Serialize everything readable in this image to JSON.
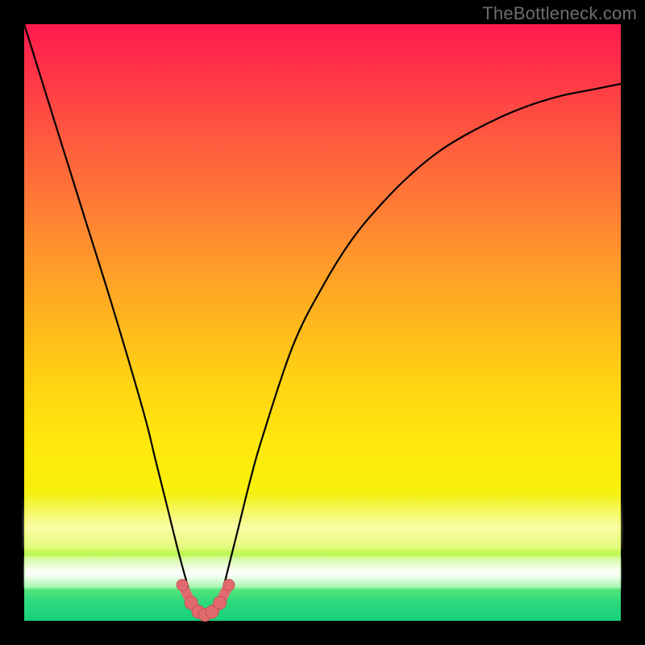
{
  "watermark": "TheBottleneck.com",
  "colors": {
    "curve_stroke": "#000000",
    "bead_fill": "#e16a6e",
    "bead_stroke": "#c94f55"
  },
  "chart_data": {
    "type": "line",
    "title": "",
    "xlabel": "",
    "ylabel": "",
    "xlim": [
      0,
      100
    ],
    "ylim": [
      0,
      100
    ],
    "series": [
      {
        "name": "curve",
        "x": [
          0,
          5,
          10,
          15,
          20,
          22,
          24,
          26,
          28,
          29,
          30,
          31,
          32,
          33,
          34,
          36,
          38,
          40,
          45,
          50,
          55,
          60,
          65,
          70,
          75,
          80,
          85,
          90,
          95,
          100
        ],
        "y": [
          100,
          84,
          68,
          52,
          35,
          27,
          19,
          11,
          4,
          2,
          1,
          1,
          2,
          4,
          8,
          16,
          24,
          31,
          46,
          56,
          64,
          70,
          75,
          79,
          82,
          84.5,
          86.5,
          88,
          89,
          90
        ]
      }
    ],
    "beads": {
      "x": [
        26.5,
        28.0,
        29.2,
        30.3,
        31.5,
        32.8,
        34.3
      ],
      "y": [
        6.0,
        3.0,
        1.5,
        1.0,
        1.5,
        3.0,
        6.0
      ]
    }
  }
}
